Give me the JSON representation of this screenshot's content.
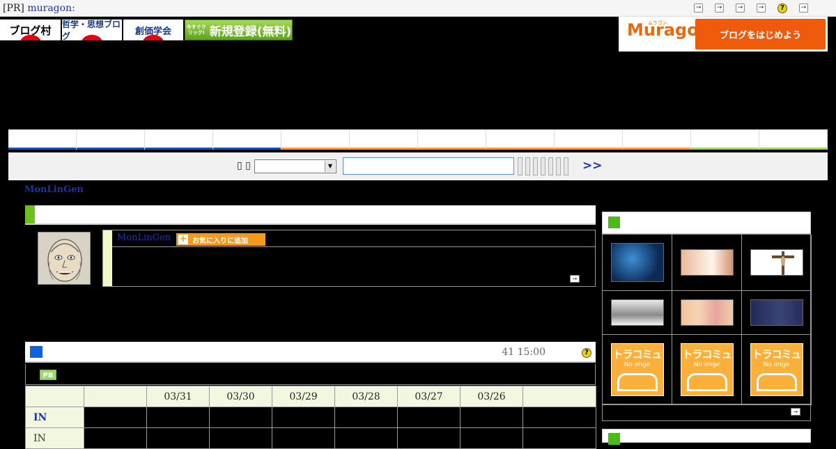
{
  "topbar": {
    "pr_label": "[PR]",
    "pr_link": "muragon:",
    "icon_glyph": "→",
    "help_glyph": "?"
  },
  "banners": {
    "blogmura": "ブログ村",
    "philosophy": "哲学・思想ブログ",
    "sokagakkai": "創価学会",
    "register_small": "今すぐクリック!",
    "register": "新規登録(無料)"
  },
  "muragon_ad": {
    "logo": "Muragon",
    "logo_kana": "ムラゴン",
    "cta": "ブログをはじめよう"
  },
  "search": {
    "label": "▯ ▯",
    "dropdown_arrow": "▼",
    "go": ">>"
  },
  "blog": {
    "name": "MonLinGen"
  },
  "profile": {
    "name": "MonLinGen",
    "favorite_plus": "+",
    "favorite_label": "お気に入りに追加",
    "more_glyph": "→"
  },
  "ranking": {
    "time": "41 15:00",
    "help_glyph": "?",
    "pb_badge": "PB",
    "dates": [
      "03/31",
      "03/30",
      "03/29",
      "03/28",
      "03/27",
      "03/26"
    ],
    "row_in": "IN",
    "row_in2": "IN"
  },
  "sidebar": {
    "no_image_title": "トラコミュ",
    "no_image_sub": "No imge",
    "more_glyph": "→"
  },
  "colors": {
    "link": "#1a33aa",
    "profile_accent": "#6dbf1a",
    "ranking_accent": "#1060e0",
    "favorite_button": "#f39a1e",
    "muragon_orange": "#f05a0c"
  }
}
